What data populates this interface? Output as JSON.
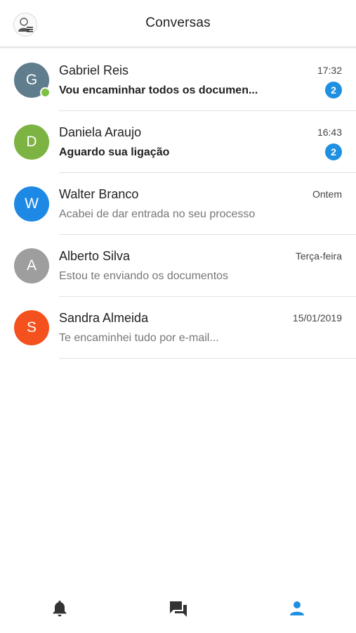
{
  "header": {
    "title": "Conversas",
    "profile_icon": "user-menu-icon"
  },
  "conversations": [
    {
      "initial": "G",
      "avatar_color": "#5f7d8c",
      "name": "Gabriel Reis",
      "preview": "Vou encaminhar todos os documen...",
      "time": "17:32",
      "unread_count": "2",
      "online": true
    },
    {
      "initial": "D",
      "avatar_color": "#7cb342",
      "name": "Daniela Araujo",
      "preview": "Aguardo sua ligação",
      "time": "16:43",
      "unread_count": "2",
      "online": false
    },
    {
      "initial": "W",
      "avatar_color": "#1e88e5",
      "name": "Walter Branco",
      "preview": "Acabei de dar entrada no seu processo",
      "time": "Ontem",
      "unread_count": "",
      "online": false
    },
    {
      "initial": "A",
      "avatar_color": "#9e9e9e",
      "name": "Alberto Silva",
      "preview": "Estou te enviando os documentos",
      "time": "Terça-feira",
      "unread_count": "",
      "online": false
    },
    {
      "initial": "S",
      "avatar_color": "#f4511e",
      "name": "Sandra Almeida",
      "preview": "Te encaminhei tudo por e-mail...",
      "time": "15/01/2019",
      "unread_count": "",
      "online": false
    }
  ],
  "bottom_nav": {
    "items": [
      {
        "icon": "bell-icon",
        "active": false
      },
      {
        "icon": "chat-icon",
        "active": false
      },
      {
        "icon": "person-icon",
        "active": true
      }
    ]
  },
  "colors": {
    "accent": "#1e8fe1",
    "online": "#7cc142",
    "inactive_nav": "#333333"
  }
}
